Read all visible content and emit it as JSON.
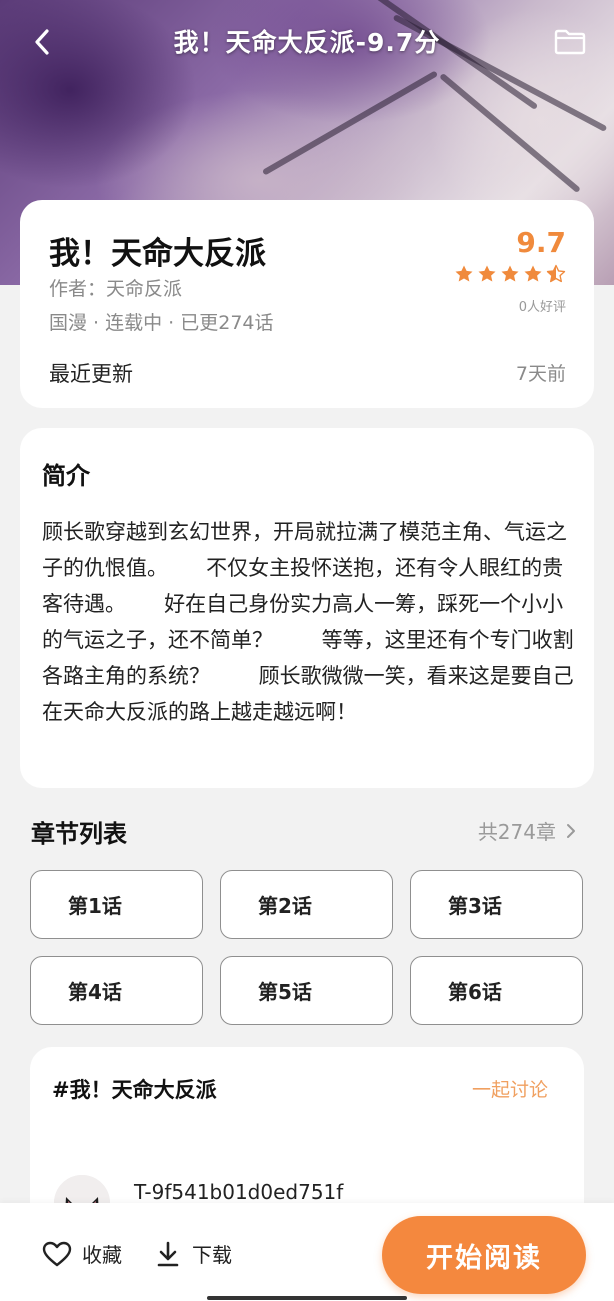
{
  "header": {
    "title": "我！天命大反派-9.7分",
    "back_icon": "chevron-left-icon",
    "folder_icon": "folder-icon"
  },
  "info": {
    "title": "我！天命大反派",
    "author": "作者：天命反派",
    "meta": "国漫 · 连载中 · 已更274话",
    "score": "9.7",
    "stars": 4.5,
    "rating_count": "0人好评",
    "recent_label": "最近更新",
    "recent_value": "7天前"
  },
  "intro": {
    "heading": "简介",
    "text": "顾长歌穿越到玄幻世界，开局就拉满了模范主角、气运之子的仇恨值。　　 不仅女主投怀送抱，还有令人眼红的贵客待遇。　　 好在自己身份实力高人一筹，踩死一个小小的气运之子，还不简单？　　 等等，这里还有个专门收割各路主角的系统？　　 顾长歌微微一笑，看来这是要自己在天命大反派的路上越走越远啊！"
  },
  "chapters": {
    "heading": "章节列表",
    "count": "共274章",
    "items": [
      "第1话",
      "第2话",
      "第3话",
      "第4话",
      "第5话",
      "第6话"
    ]
  },
  "discuss": {
    "tag": "#我！天命大反派",
    "link": "一起讨论",
    "user": "T-9f541b01d0ed751f"
  },
  "bottom": {
    "favorite": "收藏",
    "download": "下载",
    "read": "开始阅读"
  },
  "colors": {
    "accent": "#f4883e",
    "score": "#f08a3c"
  }
}
